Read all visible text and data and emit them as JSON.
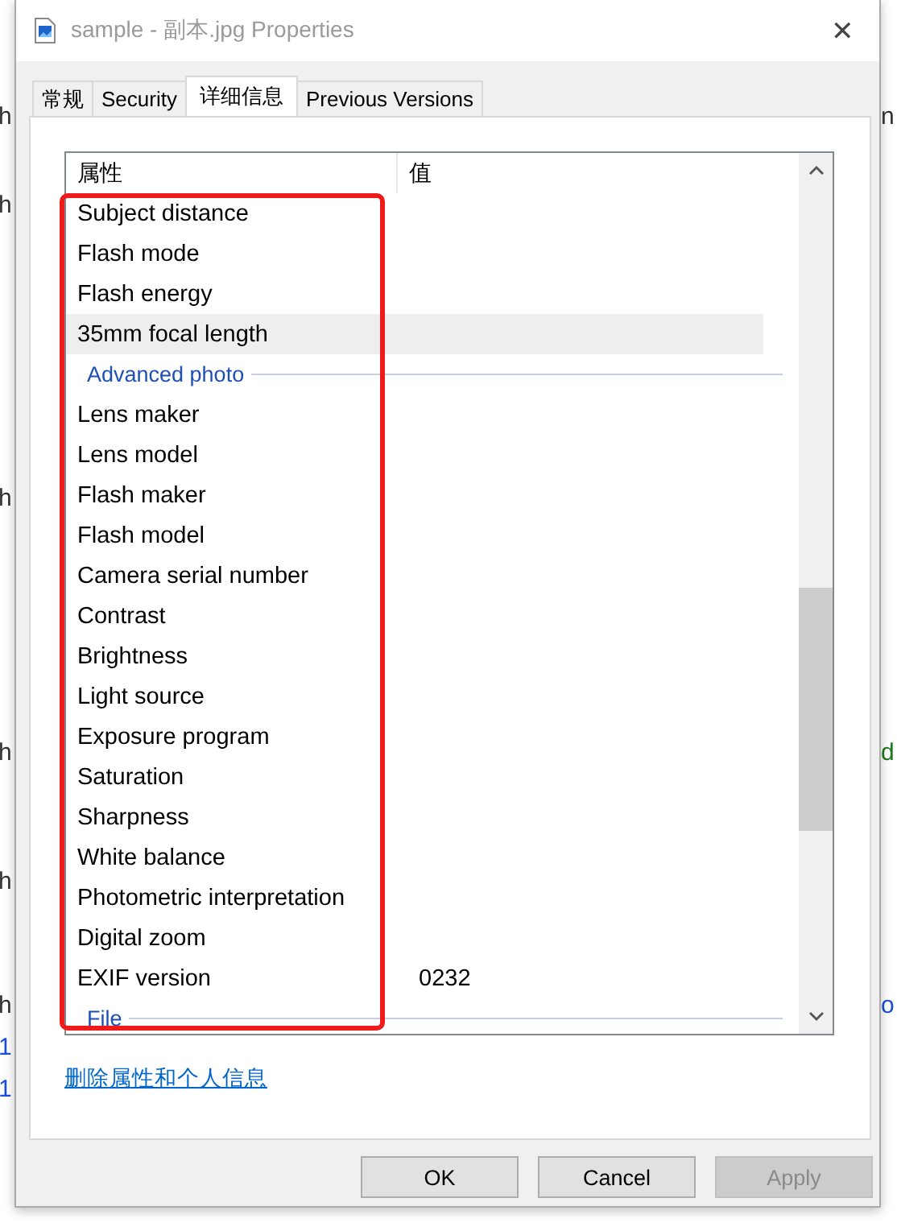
{
  "background_fragments": {
    "left": [
      {
        "text": "h",
        "color": "#333333"
      },
      {
        "text": "h",
        "color": "#333333"
      },
      {
        "text": "h",
        "color": "#333333"
      },
      {
        "text": "h",
        "color": "#333333"
      },
      {
        "text": "h",
        "color": "#333333"
      },
      {
        "text": "h",
        "color": "#333333"
      },
      {
        "text": "1",
        "color": "#1a4fd8"
      },
      {
        "text": "1",
        "color": "#1a4fd8"
      }
    ],
    "right": [
      {
        "text": "n",
        "color": "#333333"
      },
      {
        "text": "d",
        "color": "#1f7a1f"
      },
      {
        "text": "o",
        "color": "#1a4fd8"
      }
    ]
  },
  "window": {
    "title": "sample - 副本.jpg Properties",
    "close": "✕"
  },
  "tabs": [
    {
      "label": "常规",
      "selected": false
    },
    {
      "label": "Security",
      "selected": false
    },
    {
      "label": "详细信息",
      "selected": true
    },
    {
      "label": "Previous Versions",
      "selected": false
    }
  ],
  "table": {
    "columns": [
      "属性",
      "值"
    ],
    "rows": [
      {
        "kind": "property",
        "name": "Subject distance",
        "hovered": false
      },
      {
        "kind": "property",
        "name": "Flash mode",
        "hovered": false
      },
      {
        "kind": "property",
        "name": "Flash energy",
        "hovered": false
      },
      {
        "kind": "property",
        "name": "35mm focal length",
        "hovered": true
      },
      {
        "kind": "group",
        "name": "Advanced photo"
      },
      {
        "kind": "property",
        "name": "Lens maker",
        "hovered": false
      },
      {
        "kind": "property",
        "name": "Lens model",
        "hovered": false
      },
      {
        "kind": "property",
        "name": "Flash maker",
        "hovered": false
      },
      {
        "kind": "property",
        "name": "Flash model",
        "hovered": false
      },
      {
        "kind": "property",
        "name": "Camera serial number",
        "hovered": false
      },
      {
        "kind": "property",
        "name": "Contrast",
        "hovered": false
      },
      {
        "kind": "property",
        "name": "Brightness",
        "hovered": false
      },
      {
        "kind": "property",
        "name": "Light source",
        "hovered": false
      },
      {
        "kind": "property",
        "name": "Exposure program",
        "hovered": false
      },
      {
        "kind": "property",
        "name": "Saturation",
        "hovered": false
      },
      {
        "kind": "property",
        "name": "Sharpness",
        "hovered": false
      },
      {
        "kind": "property",
        "name": "White balance",
        "hovered": false
      },
      {
        "kind": "property",
        "name": "Photometric interpretation",
        "hovered": false
      },
      {
        "kind": "property",
        "name": "Digital zoom",
        "hovered": false
      },
      {
        "kind": "property",
        "name": "EXIF version",
        "value": "0232",
        "hovered": false
      },
      {
        "kind": "group",
        "name": "File"
      }
    ]
  },
  "link": "删除属性和个人信息",
  "buttons": [
    {
      "label": "OK",
      "disabled": false
    },
    {
      "label": "Cancel",
      "disabled": false
    },
    {
      "label": "Apply",
      "disabled": true
    }
  ]
}
